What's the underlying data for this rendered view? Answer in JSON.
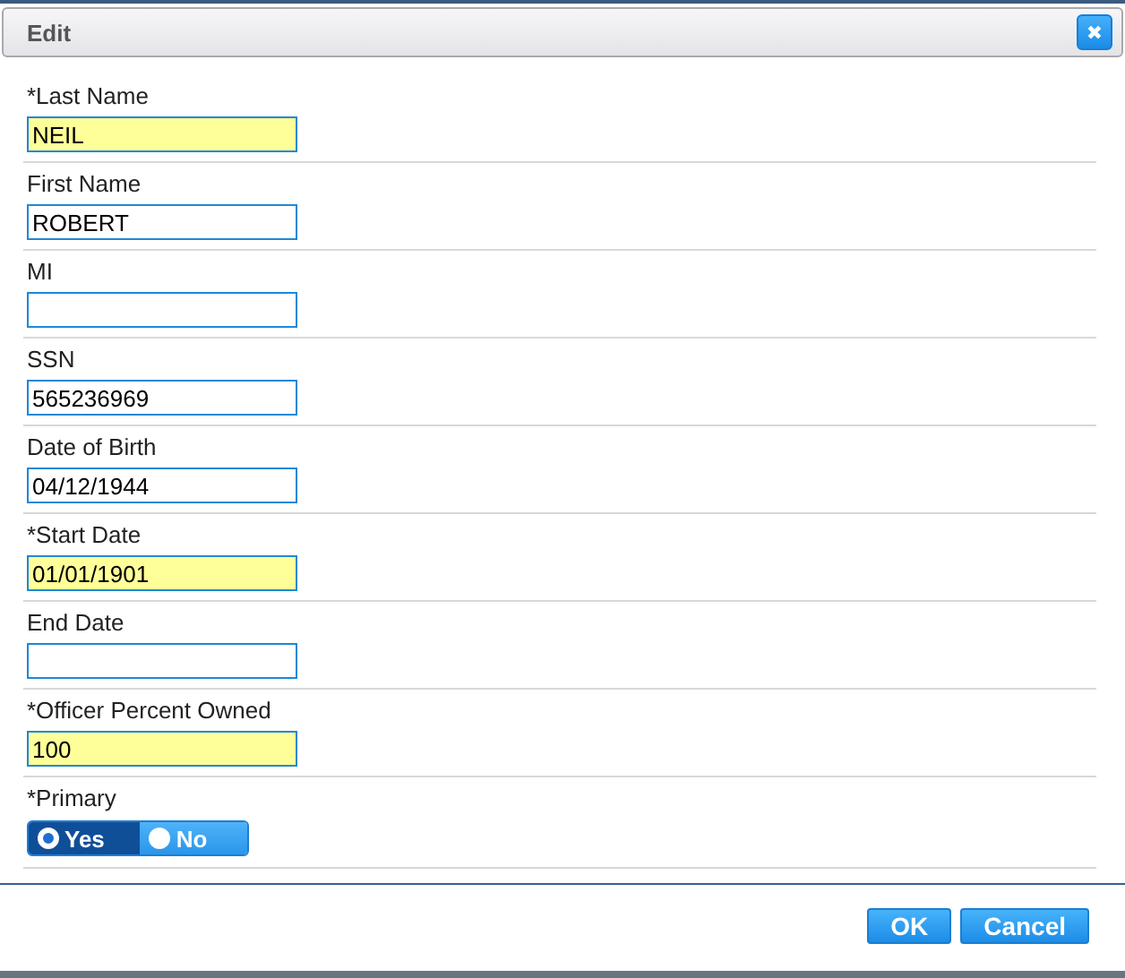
{
  "window": {
    "title": "Edit",
    "close_icon": "✖"
  },
  "fields": [
    {
      "label": "*Last Name",
      "value": "NEIL",
      "required": true
    },
    {
      "label": "First Name",
      "value": "ROBERT",
      "required": false
    },
    {
      "label": "MI",
      "required": false
    },
    {
      "label": "SSN",
      "value": "565236969",
      "required": false
    },
    {
      "label": "Date of Birth",
      "value": "04/12/1944",
      "required": false
    },
    {
      "label": "*Start Date",
      "value": "01/01/1901",
      "required": true
    },
    {
      "label": "End Date",
      "required": false
    },
    {
      "label": "*Officer Percent Owned",
      "value": "100",
      "required": true
    }
  ],
  "primary": {
    "label": "*Primary",
    "options": [
      {
        "label": "Yes",
        "selected": true
      },
      {
        "label": "No",
        "selected": false
      }
    ]
  },
  "buttons": [
    "OK",
    "Cancel"
  ]
}
